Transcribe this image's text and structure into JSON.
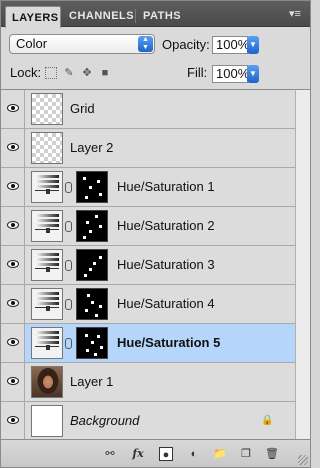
{
  "tabs": [
    {
      "label": "LAYERS",
      "active": true
    },
    {
      "label": "CHANNELS",
      "active": false
    },
    {
      "label": "PATHS",
      "active": false
    }
  ],
  "panel_menu_icon": "panel-menu-icon",
  "blend_mode": {
    "value": "Color"
  },
  "opacity": {
    "label": "Opacity:",
    "value": "100%"
  },
  "lock": {
    "label": "Lock:",
    "icons": [
      "lock-transparent-pixels-icon",
      "lock-image-pixels-icon",
      "lock-position-icon",
      "lock-all-icon"
    ]
  },
  "fill": {
    "label": "Fill:",
    "value": "100%"
  },
  "layers": [
    {
      "name": "Grid",
      "type": "pixel",
      "visible": true,
      "selected": false
    },
    {
      "name": "Layer 2",
      "type": "pixel",
      "visible": true,
      "selected": false
    },
    {
      "name": "Hue/Saturation 1",
      "type": "adjustment",
      "visible": true,
      "selected": false
    },
    {
      "name": "Hue/Saturation 2",
      "type": "adjustment",
      "visible": true,
      "selected": false
    },
    {
      "name": "Hue/Saturation 3",
      "type": "adjustment",
      "visible": true,
      "selected": false
    },
    {
      "name": "Hue/Saturation 4",
      "type": "adjustment",
      "visible": true,
      "selected": false
    },
    {
      "name": "Hue/Saturation 5",
      "type": "adjustment",
      "visible": true,
      "selected": true
    },
    {
      "name": "Layer 1",
      "type": "photo",
      "visible": true,
      "selected": false
    },
    {
      "name": "Background",
      "type": "background",
      "visible": true,
      "selected": false,
      "locked": true
    }
  ],
  "footer_icons": [
    "link-layers-icon",
    "layer-style-fx-icon",
    "add-layer-mask-icon",
    "new-adjustment-layer-icon",
    "new-group-icon",
    "new-layer-icon",
    "delete-layer-icon"
  ],
  "colors": {
    "selected_row": "#b5d5fb",
    "tab_bar": "#4f4f4f",
    "panel_bg": "#dadada"
  }
}
